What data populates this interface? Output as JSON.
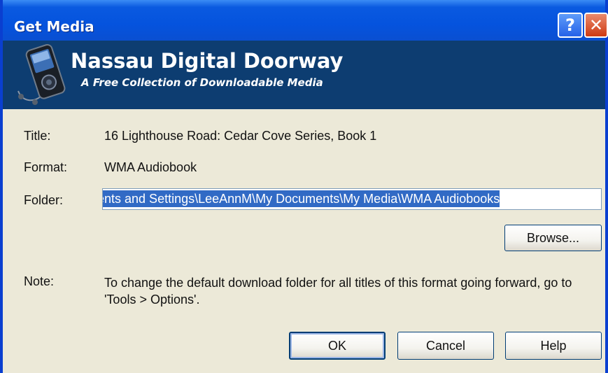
{
  "window": {
    "title": "Get Media"
  },
  "titlebar": {
    "help_label": "?",
    "close_label": "✕"
  },
  "banner": {
    "title": "Nassau Digital Doorway",
    "subtitle": "A Free Collection of Downloadable Media",
    "icon": "media-player-device-icon"
  },
  "fields": {
    "title_label": "Title:",
    "title_value": "16 Lighthouse Road: Cedar Cove Series, Book 1",
    "format_label": "Format:",
    "format_value": "WMA Audiobook",
    "folder_label": "Folder:",
    "folder_value": "cuments and Settings\\LeeAnnM\\My Documents\\My Media\\WMA Audiobooks",
    "note_label": "Note:",
    "note_text": "To change the default download folder for all titles of this format going forward, go to 'Tools > Options'."
  },
  "buttons": {
    "browse": "Browse...",
    "ok": "OK",
    "cancel": "Cancel",
    "help": "Help"
  },
  "colors": {
    "titlebar": "#0553de",
    "banner": "#0d3d71",
    "dialog_bg": "#ece9d8",
    "selection": "#316ac5"
  }
}
